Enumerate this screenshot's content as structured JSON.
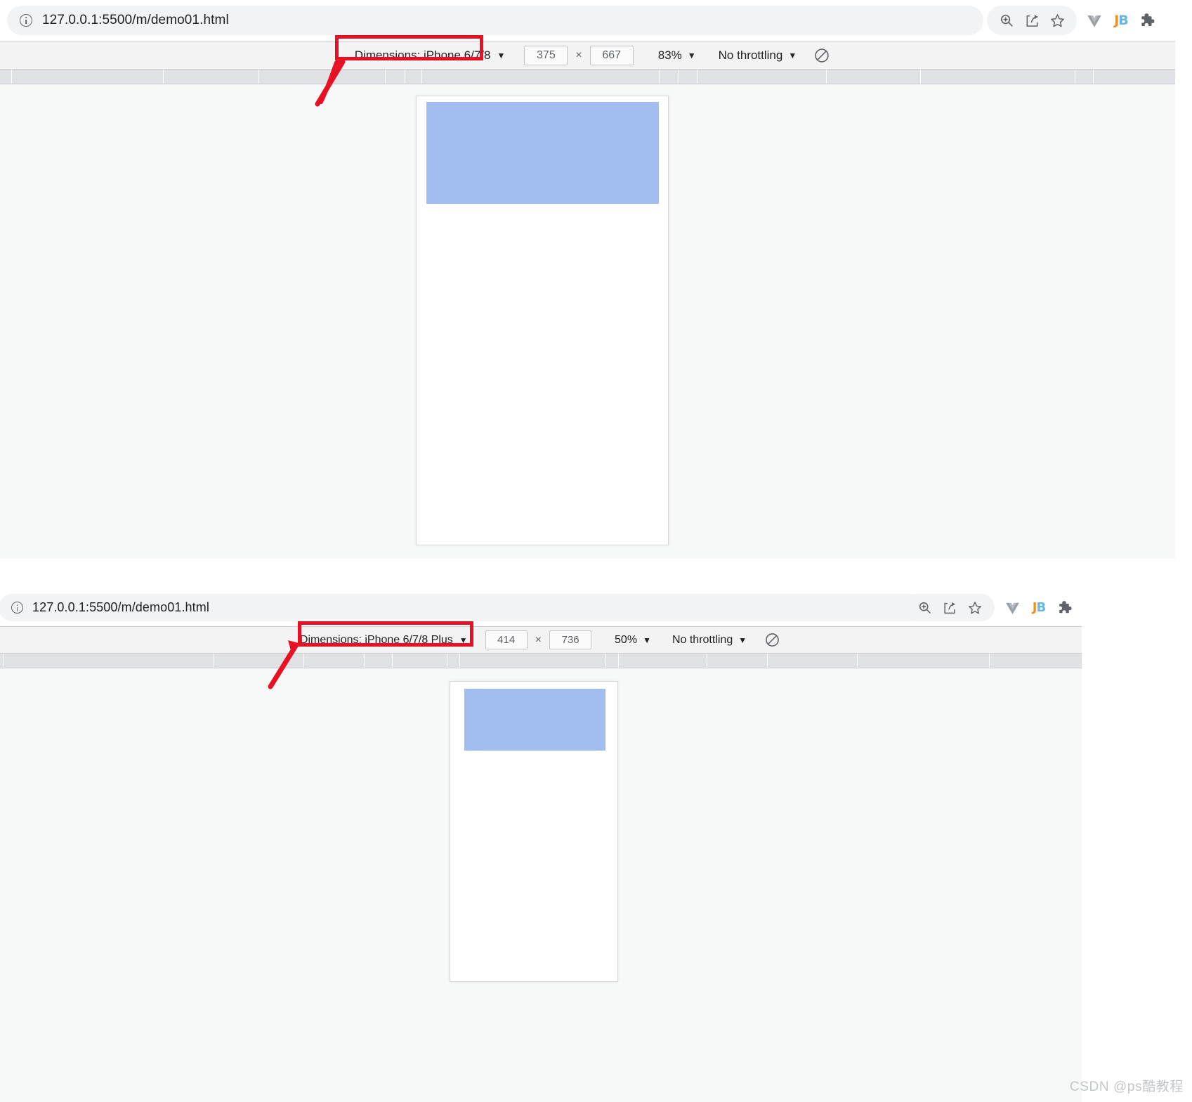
{
  "windows": [
    {
      "id": "window-top",
      "url_display": "127.0.0.1:5500/m/demo01.html",
      "url_scheme_part": "127.0.0.1",
      "url_rest": ":5500/m/demo01.html",
      "security_icon": "info-circle-icon",
      "actions": {
        "zoom_icon": "zoom-in-icon",
        "share_icon": "share-icon",
        "bookmark_icon": "star-outline-icon",
        "vue_devtools_icon": "vue-devtools-icon",
        "jetbrains_icon": "jetbrains-ide-icon",
        "jetbrains_text_j": "J",
        "jetbrains_text_b": "B",
        "extensions_icon": "puzzle-piece-icon"
      },
      "device_toolbar": {
        "dimensions_label": "Dimensions: iPhone 6/7/8",
        "dimensions_caret": "▼",
        "width_value": "375",
        "height_value": "667",
        "multiply_symbol": "×",
        "zoom_value": "83%",
        "zoom_caret": "▼",
        "throttling_value": "No throttling",
        "throttling_caret": "▼",
        "rotate_icon": "rotate-device-icon"
      },
      "viewport": {
        "device_width_css": "375",
        "device_height_css": "667",
        "scale_percent": "83%",
        "block_color": "#a2bdf0",
        "page_background": "#ffffff"
      }
    },
    {
      "id": "window-bottom",
      "url_display": "127.0.0.1:5500/m/demo01.html",
      "url_scheme_part": "127.0.0.1",
      "url_rest": ":5500/m/demo01.html",
      "security_icon": "info-circle-icon",
      "actions": {
        "zoom_icon": "zoom-in-icon",
        "share_icon": "share-icon",
        "bookmark_icon": "star-outline-icon",
        "vue_devtools_icon": "vue-devtools-icon",
        "jetbrains_icon": "jetbrains-ide-icon",
        "jetbrains_text_j": "J",
        "jetbrains_text_b": "B",
        "extensions_icon": "puzzle-piece-icon"
      },
      "device_toolbar": {
        "dimensions_label": "Dimensions: iPhone 6/7/8 Plus",
        "dimensions_caret": "▼",
        "width_value": "414",
        "height_value": "736",
        "multiply_symbol": "×",
        "zoom_value": "50%",
        "zoom_caret": "▼",
        "throttling_value": "No throttling",
        "throttling_caret": "▼",
        "rotate_icon": "rotate-device-icon"
      },
      "viewport": {
        "device_width_css": "414",
        "device_height_css": "736",
        "scale_percent": "50%",
        "block_color": "#a2bdf0",
        "page_background": "#ffffff"
      }
    }
  ],
  "annotations": {
    "color": "#e81123",
    "highlight_1_target": "dimensions-dropdown-top",
    "highlight_2_target": "dimensions-dropdown-bottom"
  },
  "watermark": {
    "text": "CSDN @ps酷教程"
  }
}
